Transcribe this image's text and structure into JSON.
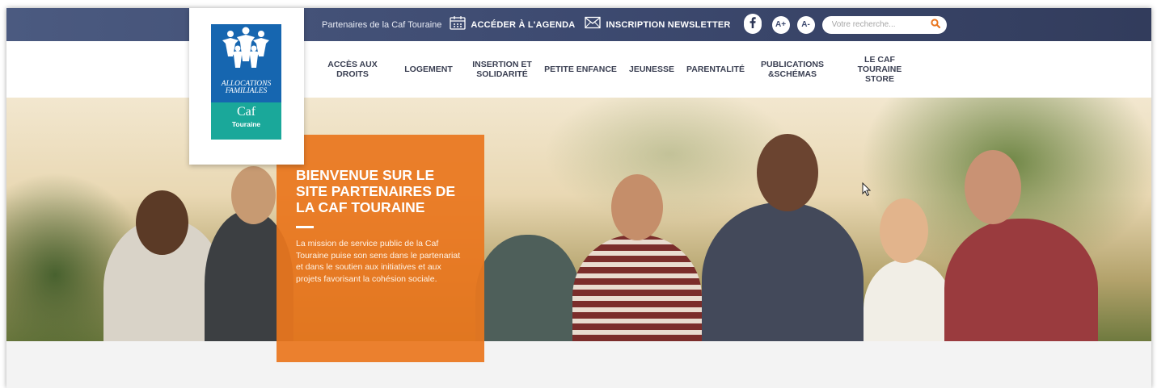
{
  "topbar": {
    "partners_link": "Partenaires de la Caf Touraine",
    "agenda_label": "ACCÉDER À L'AGENDA",
    "newsletter_label": "INSCRIPTION NEWSLETTER",
    "font_increase": "A+",
    "font_decrease": "A-",
    "search_placeholder": "Votre recherche..."
  },
  "logo": {
    "line1": "ALLOCATIONS",
    "line2": "FAMILIALES",
    "caf": "Caf",
    "region": "Touraine"
  },
  "nav": {
    "items": [
      {
        "label": "ACCÈS AUX\nDROITS"
      },
      {
        "label": "LOGEMENT"
      },
      {
        "label": "INSERTION ET\nSOLIDARITÉ"
      },
      {
        "label": "PETITE ENFANCE"
      },
      {
        "label": "JEUNESSE"
      },
      {
        "label": "PARENTALITÉ"
      },
      {
        "label": "PUBLICATIONS\n&SCHÉMAS"
      },
      {
        "label": "LE CAF\nTOURAINE\nSTORE"
      }
    ]
  },
  "hero": {
    "title": "BIENVENUE SUR LE SITE PARTENAIRES DE LA CAF TOURAINE",
    "text": "La mission de service public de la Caf Touraine puise son sens dans le partenariat et dans le soutien aux initiatives et aux projets favorisant la cohésion sociale."
  },
  "colors": {
    "topbar": "#3d4a70",
    "accent_orange": "#e9761e",
    "logo_blue": "#1666b0",
    "logo_teal": "#1aa89a",
    "search_icon": "#e9761e"
  },
  "icons": [
    "calendar-icon",
    "envelope-icon",
    "facebook-icon",
    "search-icon",
    "cursor-icon"
  ]
}
